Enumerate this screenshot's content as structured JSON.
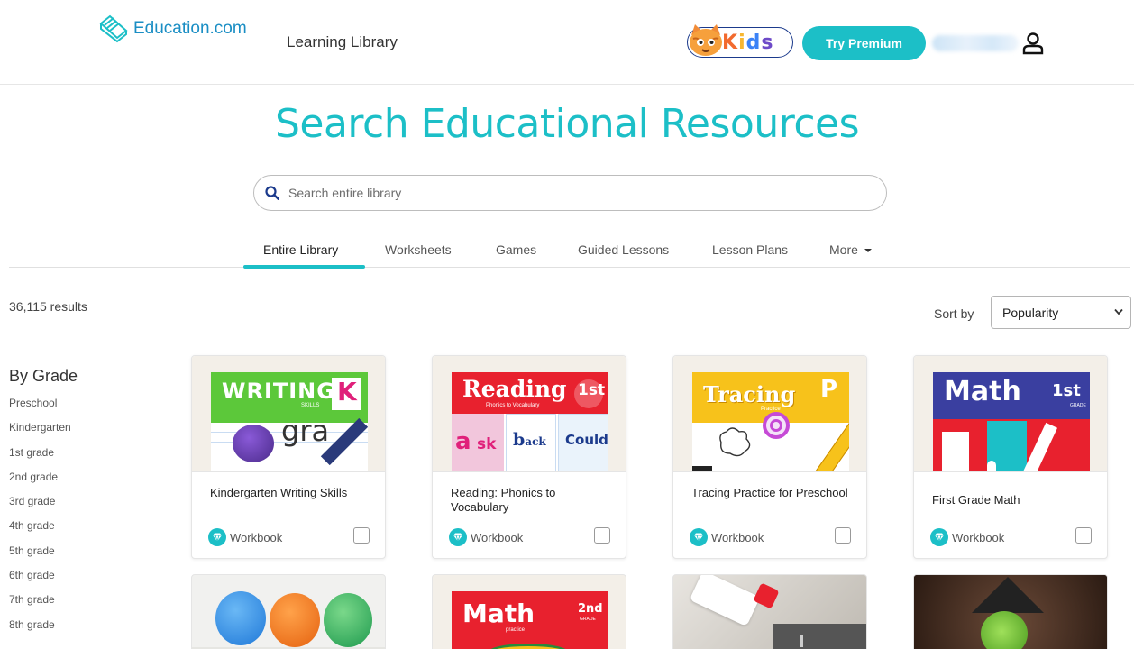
{
  "header": {
    "logo_text": "Education.com",
    "nav_link": "Learning Library",
    "premium_label": "Try Premium"
  },
  "page_title": "Search Educational Resources",
  "search": {
    "placeholder": "Search entire library"
  },
  "tabs": [
    {
      "label": "Entire Library",
      "active": true
    },
    {
      "label": "Worksheets"
    },
    {
      "label": "Games"
    },
    {
      "label": "Guided Lessons"
    },
    {
      "label": "Lesson Plans"
    },
    {
      "label": "More"
    }
  ],
  "results": {
    "count": "36,115 results"
  },
  "sort": {
    "label": "Sort by",
    "selected": "Popularity"
  },
  "sidebar": {
    "heading": "By Grade",
    "grades": [
      "Preschool",
      "Kindergarten",
      "1st grade",
      "2nd grade",
      "3rd grade",
      "4th grade",
      "5th grade",
      "6th grade",
      "7th grade",
      "8th grade"
    ]
  },
  "cards": [
    {
      "title": "Kindergarten Writing Skills",
      "type": "Workbook",
      "cover_word": "WRITING",
      "cover_badge": "K",
      "cover_sub": "SKILLS"
    },
    {
      "title": "Reading: Phonics to Vocabulary",
      "type": "Workbook",
      "cover_word": "Reading",
      "cover_badge": "1st",
      "cover_sub": "Phonics to Vocabulary"
    },
    {
      "title": "Tracing Practice for Preschool",
      "type": "Workbook",
      "cover_word": "Tracing",
      "cover_badge": "P",
      "cover_sub": "Practice"
    },
    {
      "title": "First Grade Math",
      "type": "Workbook",
      "cover_word": "Math",
      "cover_badge": "1st",
      "cover_sub": "GRADE"
    }
  ],
  "cards_row2": [
    {
      "cover_word": "Math",
      "cover_badge": "2nd",
      "cover_sub": "practice",
      "cover_sub2": "GRADE"
    }
  ],
  "colors": {
    "accent": "#1cbfc7",
    "brand_blue": "#1a8ec4"
  }
}
